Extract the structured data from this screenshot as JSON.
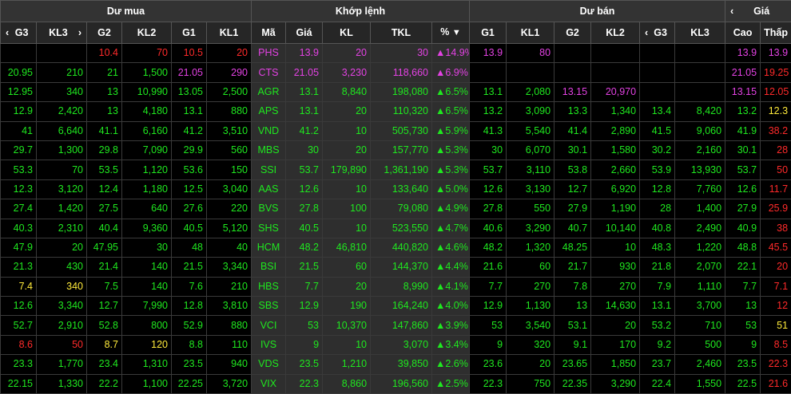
{
  "header": {
    "group_buy": "Dư mua",
    "group_match": "Khớp lệnh",
    "group_sell": "Dư bán",
    "group_price": "Giá",
    "buy_cols": [
      "G3",
      "KL3",
      "G2",
      "KL2",
      "G1",
      "KL1"
    ],
    "match_cols": [
      "Mã",
      "Giá",
      "KL",
      "TKL",
      "%"
    ],
    "sell_cols": [
      "G1",
      "KL1",
      "G2",
      "KL2",
      "G3",
      "KL3"
    ],
    "price_cols": [
      "Cao",
      "Thấp"
    ],
    "icons": {
      "nav_left": "‹",
      "nav_right": "›",
      "sort_desc": "▼"
    }
  },
  "colors": {
    "up": "#1fe81f",
    "down": "#ff2a2a",
    "reference": "#ffeb3b",
    "ceiling": "#e442e4"
  },
  "rows": [
    {
      "b": [
        [
          "",
          ""
        ],
        [
          "",
          ""
        ],
        [
          "10.4",
          "down"
        ],
        [
          "70",
          "down"
        ],
        [
          "10.5",
          "down"
        ],
        [
          "20",
          "down"
        ]
      ],
      "sym": "PHS",
      "price": "13.9",
      "vol": "20",
      "tvol": "30",
      "pct": "▲14.9%",
      "mc": "ceil",
      "s": [
        [
          "13.9",
          "ceil"
        ],
        [
          "80",
          "ceil"
        ],
        [
          "",
          ""
        ],
        [
          "",
          ""
        ],
        [
          "",
          ""
        ],
        [
          "",
          ""
        ]
      ],
      "hi": [
        "13.9",
        "ceil"
      ],
      "lo": [
        "13.9",
        "ceil"
      ]
    },
    {
      "b": [
        [
          "20.95",
          "up"
        ],
        [
          "210",
          "up"
        ],
        [
          "21",
          "up"
        ],
        [
          "1,500",
          "up"
        ],
        [
          "21.05",
          "ceil"
        ],
        [
          "290",
          "ceil"
        ]
      ],
      "sym": "CTS",
      "price": "21.05",
      "vol": "3,230",
      "tvol": "118,660",
      "pct": "▲6.9%",
      "mc": "ceil",
      "s": [
        [
          "",
          ""
        ],
        [
          "",
          ""
        ],
        [
          "",
          ""
        ],
        [
          "",
          ""
        ],
        [
          "",
          ""
        ],
        [
          "",
          ""
        ]
      ],
      "hi": [
        "21.05",
        "ceil"
      ],
      "lo": [
        "19.25",
        "down"
      ]
    },
    {
      "b": [
        [
          "12.95",
          "up"
        ],
        [
          "340",
          "up"
        ],
        [
          "13",
          "up"
        ],
        [
          "10,990",
          "up"
        ],
        [
          "13.05",
          "up"
        ],
        [
          "2,500",
          "up"
        ]
      ],
      "sym": "AGR",
      "price": "13.1",
      "vol": "8,840",
      "tvol": "198,080",
      "pct": "▲6.5%",
      "mc": "up",
      "s": [
        [
          "13.1",
          "up"
        ],
        [
          "2,080",
          "up"
        ],
        [
          "13.15",
          "ceil"
        ],
        [
          "20,970",
          "ceil"
        ],
        [
          "",
          ""
        ],
        [
          "",
          ""
        ]
      ],
      "hi": [
        "13.15",
        "ceil"
      ],
      "lo": [
        "12.05",
        "down"
      ]
    },
    {
      "b": [
        [
          "12.9",
          "up"
        ],
        [
          "2,420",
          "up"
        ],
        [
          "13",
          "up"
        ],
        [
          "4,180",
          "up"
        ],
        [
          "13.1",
          "up"
        ],
        [
          "880",
          "up"
        ]
      ],
      "sym": "APS",
      "price": "13.1",
      "vol": "20",
      "tvol": "110,320",
      "pct": "▲6.5%",
      "mc": "up",
      "s": [
        [
          "13.2",
          "up"
        ],
        [
          "3,090",
          "up"
        ],
        [
          "13.3",
          "up"
        ],
        [
          "1,340",
          "up"
        ],
        [
          "13.4",
          "up"
        ],
        [
          "8,420",
          "up"
        ]
      ],
      "hi": [
        "13.2",
        "up"
      ],
      "lo": [
        "12.3",
        "ref"
      ]
    },
    {
      "b": [
        [
          "41",
          "up"
        ],
        [
          "6,640",
          "up"
        ],
        [
          "41.1",
          "up"
        ],
        [
          "6,160",
          "up"
        ],
        [
          "41.2",
          "up"
        ],
        [
          "3,510",
          "up"
        ]
      ],
      "sym": "VND",
      "price": "41.2",
      "vol": "10",
      "tvol": "505,730",
      "pct": "▲5.9%",
      "mc": "up",
      "s": [
        [
          "41.3",
          "up"
        ],
        [
          "5,540",
          "up"
        ],
        [
          "41.4",
          "up"
        ],
        [
          "2,890",
          "up"
        ],
        [
          "41.5",
          "up"
        ],
        [
          "9,060",
          "up"
        ]
      ],
      "hi": [
        "41.9",
        "up"
      ],
      "lo": [
        "38.2",
        "down"
      ]
    },
    {
      "b": [
        [
          "29.7",
          "up"
        ],
        [
          "1,300",
          "up"
        ],
        [
          "29.8",
          "up"
        ],
        [
          "7,090",
          "up"
        ],
        [
          "29.9",
          "up"
        ],
        [
          "560",
          "up"
        ]
      ],
      "sym": "MBS",
      "price": "30",
      "vol": "20",
      "tvol": "157,770",
      "pct": "▲5.3%",
      "mc": "up",
      "s": [
        [
          "30",
          "up"
        ],
        [
          "6,070",
          "up"
        ],
        [
          "30.1",
          "up"
        ],
        [
          "1,580",
          "up"
        ],
        [
          "30.2",
          "up"
        ],
        [
          "2,160",
          "up"
        ]
      ],
      "hi": [
        "30.1",
        "up"
      ],
      "lo": [
        "28",
        "down"
      ]
    },
    {
      "b": [
        [
          "53.3",
          "up"
        ],
        [
          "70",
          "up"
        ],
        [
          "53.5",
          "up"
        ],
        [
          "1,120",
          "up"
        ],
        [
          "53.6",
          "up"
        ],
        [
          "150",
          "up"
        ]
      ],
      "sym": "SSI",
      "price": "53.7",
      "vol": "179,890",
      "tvol": "1,361,190",
      "pct": "▲5.3%",
      "mc": "up",
      "s": [
        [
          "53.7",
          "up"
        ],
        [
          "3,110",
          "up"
        ],
        [
          "53.8",
          "up"
        ],
        [
          "2,660",
          "up"
        ],
        [
          "53.9",
          "up"
        ],
        [
          "13,930",
          "up"
        ]
      ],
      "hi": [
        "53.7",
        "up"
      ],
      "lo": [
        "50",
        "down"
      ]
    },
    {
      "b": [
        [
          "12.3",
          "up"
        ],
        [
          "3,120",
          "up"
        ],
        [
          "12.4",
          "up"
        ],
        [
          "1,180",
          "up"
        ],
        [
          "12.5",
          "up"
        ],
        [
          "3,040",
          "up"
        ]
      ],
      "sym": "AAS",
      "price": "12.6",
      "vol": "10",
      "tvol": "133,640",
      "pct": "▲5.0%",
      "mc": "up",
      "s": [
        [
          "12.6",
          "up"
        ],
        [
          "3,130",
          "up"
        ],
        [
          "12.7",
          "up"
        ],
        [
          "6,920",
          "up"
        ],
        [
          "12.8",
          "up"
        ],
        [
          "7,760",
          "up"
        ]
      ],
      "hi": [
        "12.6",
        "up"
      ],
      "lo": [
        "11.7",
        "down"
      ]
    },
    {
      "b": [
        [
          "27.4",
          "up"
        ],
        [
          "1,420",
          "up"
        ],
        [
          "27.5",
          "up"
        ],
        [
          "640",
          "up"
        ],
        [
          "27.6",
          "up"
        ],
        [
          "220",
          "up"
        ]
      ],
      "sym": "BVS",
      "price": "27.8",
      "vol": "100",
      "tvol": "79,080",
      "pct": "▲4.9%",
      "mc": "up",
      "s": [
        [
          "27.8",
          "up"
        ],
        [
          "550",
          "up"
        ],
        [
          "27.9",
          "up"
        ],
        [
          "1,190",
          "up"
        ],
        [
          "28",
          "up"
        ],
        [
          "1,400",
          "up"
        ]
      ],
      "hi": [
        "27.9",
        "up"
      ],
      "lo": [
        "25.9",
        "down"
      ]
    },
    {
      "b": [
        [
          "40.3",
          "up"
        ],
        [
          "2,310",
          "up"
        ],
        [
          "40.4",
          "up"
        ],
        [
          "9,360",
          "up"
        ],
        [
          "40.5",
          "up"
        ],
        [
          "5,120",
          "up"
        ]
      ],
      "sym": "SHS",
      "price": "40.5",
      "vol": "10",
      "tvol": "523,550",
      "pct": "▲4.7%",
      "mc": "up",
      "s": [
        [
          "40.6",
          "up"
        ],
        [
          "3,290",
          "up"
        ],
        [
          "40.7",
          "up"
        ],
        [
          "10,140",
          "up"
        ],
        [
          "40.8",
          "up"
        ],
        [
          "2,490",
          "up"
        ]
      ],
      "hi": [
        "40.9",
        "up"
      ],
      "lo": [
        "38",
        "down"
      ]
    },
    {
      "b": [
        [
          "47.9",
          "up"
        ],
        [
          "20",
          "up"
        ],
        [
          "47.95",
          "up"
        ],
        [
          "30",
          "up"
        ],
        [
          "48",
          "up"
        ],
        [
          "40",
          "up"
        ]
      ],
      "sym": "HCM",
      "price": "48.2",
      "vol": "46,810",
      "tvol": "440,820",
      "pct": "▲4.6%",
      "mc": "up",
      "s": [
        [
          "48.2",
          "up"
        ],
        [
          "1,320",
          "up"
        ],
        [
          "48.25",
          "up"
        ],
        [
          "10",
          "up"
        ],
        [
          "48.3",
          "up"
        ],
        [
          "1,220",
          "up"
        ]
      ],
      "hi": [
        "48.8",
        "up"
      ],
      "lo": [
        "45.5",
        "down"
      ]
    },
    {
      "b": [
        [
          "21.3",
          "up"
        ],
        [
          "430",
          "up"
        ],
        [
          "21.4",
          "up"
        ],
        [
          "140",
          "up"
        ],
        [
          "21.5",
          "up"
        ],
        [
          "3,340",
          "up"
        ]
      ],
      "sym": "BSI",
      "price": "21.5",
      "vol": "60",
      "tvol": "144,370",
      "pct": "▲4.4%",
      "mc": "up",
      "s": [
        [
          "21.6",
          "up"
        ],
        [
          "60",
          "up"
        ],
        [
          "21.7",
          "up"
        ],
        [
          "930",
          "up"
        ],
        [
          "21.8",
          "up"
        ],
        [
          "2,070",
          "up"
        ]
      ],
      "hi": [
        "22.1",
        "up"
      ],
      "lo": [
        "20",
        "down"
      ]
    },
    {
      "b": [
        [
          "7.4",
          "ref"
        ],
        [
          "340",
          "ref"
        ],
        [
          "7.5",
          "up"
        ],
        [
          "140",
          "up"
        ],
        [
          "7.6",
          "up"
        ],
        [
          "210",
          "up"
        ]
      ],
      "sym": "HBS",
      "price": "7.7",
      "vol": "20",
      "tvol": "8,990",
      "pct": "▲4.1%",
      "mc": "up",
      "s": [
        [
          "7.7",
          "up"
        ],
        [
          "270",
          "up"
        ],
        [
          "7.8",
          "up"
        ],
        [
          "270",
          "up"
        ],
        [
          "7.9",
          "up"
        ],
        [
          "1,110",
          "up"
        ]
      ],
      "hi": [
        "7.7",
        "up"
      ],
      "lo": [
        "7.1",
        "down"
      ]
    },
    {
      "b": [
        [
          "12.6",
          "up"
        ],
        [
          "3,340",
          "up"
        ],
        [
          "12.7",
          "up"
        ],
        [
          "7,990",
          "up"
        ],
        [
          "12.8",
          "up"
        ],
        [
          "3,810",
          "up"
        ]
      ],
      "sym": "SBS",
      "price": "12.9",
      "vol": "190",
      "tvol": "164,240",
      "pct": "▲4.0%",
      "mc": "up",
      "s": [
        [
          "12.9",
          "up"
        ],
        [
          "1,130",
          "up"
        ],
        [
          "13",
          "up"
        ],
        [
          "14,630",
          "up"
        ],
        [
          "13.1",
          "up"
        ],
        [
          "3,700",
          "up"
        ]
      ],
      "hi": [
        "13",
        "up"
      ],
      "lo": [
        "12",
        "down"
      ]
    },
    {
      "b": [
        [
          "52.7",
          "up"
        ],
        [
          "2,910",
          "up"
        ],
        [
          "52.8",
          "up"
        ],
        [
          "800",
          "up"
        ],
        [
          "52.9",
          "up"
        ],
        [
          "880",
          "up"
        ]
      ],
      "sym": "VCI",
      "price": "53",
      "vol": "10,370",
      "tvol": "147,860",
      "pct": "▲3.9%",
      "mc": "up",
      "s": [
        [
          "53",
          "up"
        ],
        [
          "3,540",
          "up"
        ],
        [
          "53.1",
          "up"
        ],
        [
          "20",
          "up"
        ],
        [
          "53.2",
          "up"
        ],
        [
          "710",
          "up"
        ]
      ],
      "hi": [
        "53",
        "up"
      ],
      "lo": [
        "51",
        "ref"
      ]
    },
    {
      "b": [
        [
          "8.6",
          "down"
        ],
        [
          "50",
          "down"
        ],
        [
          "8.7",
          "ref"
        ],
        [
          "120",
          "ref"
        ],
        [
          "8.8",
          "up"
        ],
        [
          "110",
          "up"
        ]
      ],
      "sym": "IVS",
      "price": "9",
      "vol": "10",
      "tvol": "3,070",
      "pct": "▲3.4%",
      "mc": "up",
      "s": [
        [
          "9",
          "up"
        ],
        [
          "320",
          "up"
        ],
        [
          "9.1",
          "up"
        ],
        [
          "170",
          "up"
        ],
        [
          "9.2",
          "up"
        ],
        [
          "500",
          "up"
        ]
      ],
      "hi": [
        "9",
        "up"
      ],
      "lo": [
        "8.5",
        "down"
      ]
    },
    {
      "b": [
        [
          "23.3",
          "up"
        ],
        [
          "1,770",
          "up"
        ],
        [
          "23.4",
          "up"
        ],
        [
          "1,310",
          "up"
        ],
        [
          "23.5",
          "up"
        ],
        [
          "940",
          "up"
        ]
      ],
      "sym": "VDS",
      "price": "23.5",
      "vol": "1,210",
      "tvol": "39,850",
      "pct": "▲2.6%",
      "mc": "up",
      "s": [
        [
          "23.6",
          "up"
        ],
        [
          "20",
          "up"
        ],
        [
          "23.65",
          "up"
        ],
        [
          "1,850",
          "up"
        ],
        [
          "23.7",
          "up"
        ],
        [
          "2,460",
          "up"
        ]
      ],
      "hi": [
        "23.5",
        "up"
      ],
      "lo": [
        "22.3",
        "down"
      ]
    },
    {
      "b": [
        [
          "22.15",
          "up"
        ],
        [
          "1,330",
          "up"
        ],
        [
          "22.2",
          "up"
        ],
        [
          "1,100",
          "up"
        ],
        [
          "22.25",
          "up"
        ],
        [
          "3,720",
          "up"
        ]
      ],
      "sym": "VIX",
      "price": "22.3",
      "vol": "8,860",
      "tvol": "196,560",
      "pct": "▲2.5%",
      "mc": "up",
      "s": [
        [
          "22.3",
          "up"
        ],
        [
          "750",
          "up"
        ],
        [
          "22.35",
          "up"
        ],
        [
          "3,290",
          "up"
        ],
        [
          "22.4",
          "up"
        ],
        [
          "1,550",
          "up"
        ]
      ],
      "hi": [
        "22.5",
        "up"
      ],
      "lo": [
        "21.6",
        "down"
      ]
    }
  ]
}
